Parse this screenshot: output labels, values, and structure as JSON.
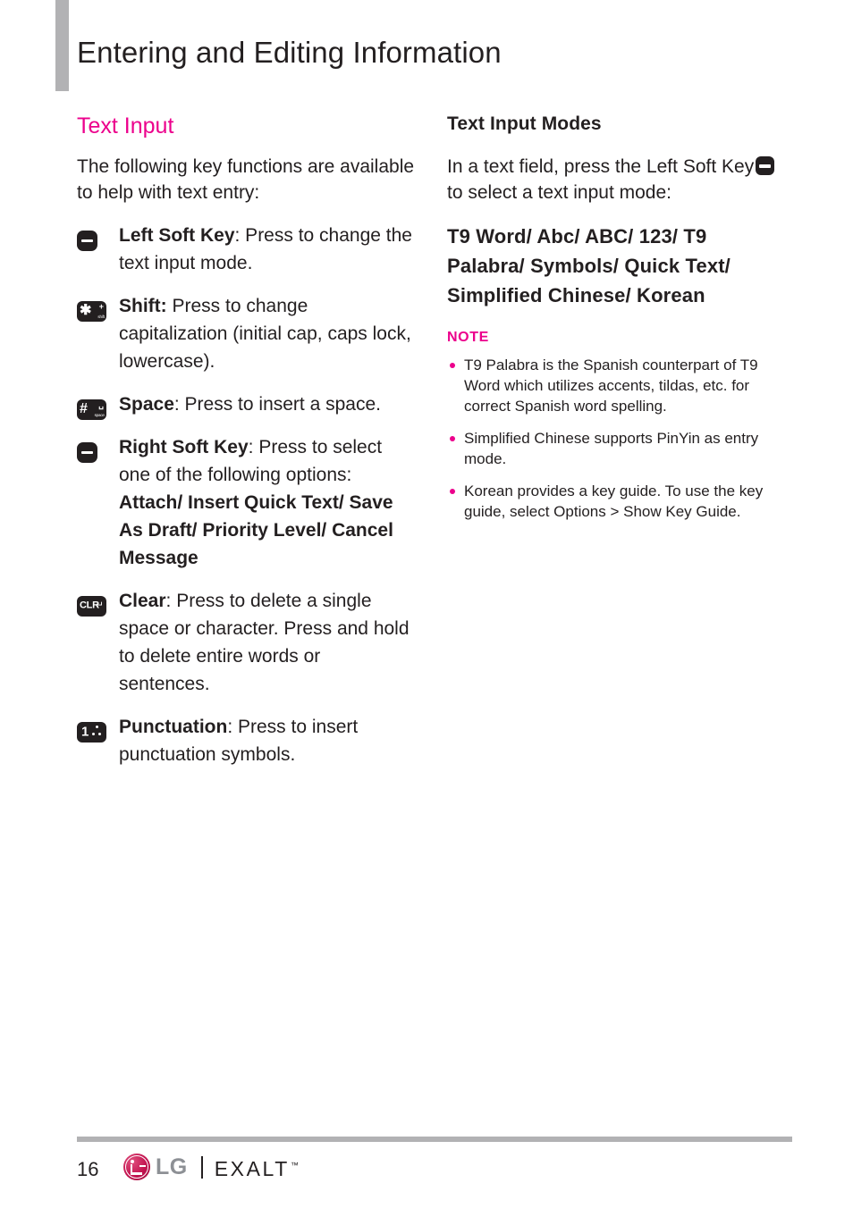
{
  "header": {
    "title": "Entering and Editing Information"
  },
  "left_column": {
    "heading": "Text Input",
    "intro": "The following key functions are available to help with text entry:",
    "keys": [
      {
        "icon": "left-soft-key-icon",
        "icon_type": "soft",
        "name": "Left Soft Key",
        "desc": ": Press to change the text input mode.",
        "sub": ""
      },
      {
        "icon": "shift-key-icon",
        "icon_type": "shift",
        "icon_main": "✱",
        "icon_sup": "+",
        "icon_sub": "shift",
        "name": "Shift:",
        "desc": " Press to change capitalization (initial cap, caps lock, lowercase).",
        "sub": ""
      },
      {
        "icon": "space-key-icon",
        "icon_type": "space",
        "icon_main": "#",
        "icon_sup": "␣",
        "icon_sub": "space",
        "name": "Space",
        "desc": ": Press to insert a space.",
        "sub": ""
      },
      {
        "icon": "right-soft-key-icon",
        "icon_type": "soft",
        "name": "Right Soft Key",
        "desc": ": Press to select one of the following options:",
        "sub": "Attach/ Insert Quick Text/ Save As Draft/ Priority Level/ Cancel Message"
      },
      {
        "icon": "clear-key-icon",
        "icon_type": "clr",
        "icon_main": "CLR",
        "icon_sup": "↵",
        "name": "Clear",
        "desc": ": Press to delete a single space or character. Press and hold to delete entire words or sentences.",
        "sub": ""
      },
      {
        "icon": "punctuation-key-icon",
        "icon_type": "punct",
        "icon_main": "1",
        "name": "Punctuation",
        "desc": ": Press to insert punctuation symbols.",
        "sub": ""
      }
    ]
  },
  "right_column": {
    "heading": "Text Input Modes",
    "intro_before": "In a text field, press the Left Soft Key",
    "intro_after": "to select a text input mode:",
    "modes": "T9 Word/ Abc/ ABC/ 123/ T9 Palabra/ Symbols/ Quick Text/ Simplified Chinese/ Korean",
    "note_label": "NOTE",
    "notes": [
      "T9 Palabra is the Spanish counterpart of T9 Word which utilizes accents, tildas, etc. for correct Spanish word spelling.",
      "Simplified Chinese supports PinYin as entry mode.",
      "Korean provides a key guide. To use the key guide, select Options > Show Key Guide."
    ]
  },
  "footer": {
    "page_number": "16",
    "brand_lg": "LG",
    "brand_model": "EXALT",
    "brand_tm": "™"
  },
  "colors": {
    "accent_pink": "#ec008c",
    "text": "#231f20",
    "rule_gray": "#b2b2b4",
    "lg_gray": "#8d9095",
    "lg_crimson": "#c2134f"
  }
}
